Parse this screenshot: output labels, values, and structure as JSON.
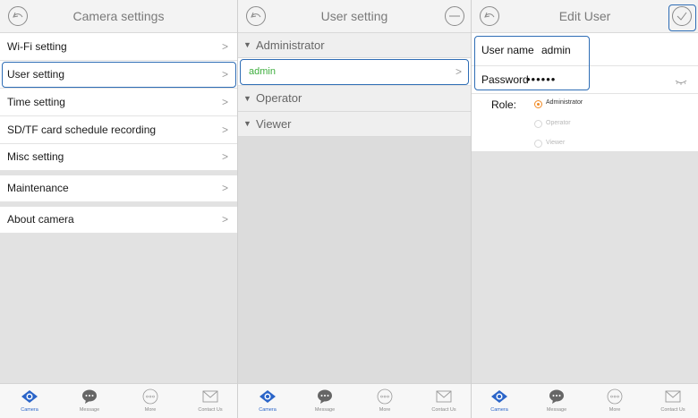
{
  "colors": {
    "accent": "#2a64c8",
    "highlight": "#2e6db5",
    "active_user": "#3fae3f",
    "radio_on": "#f08a25"
  },
  "panel1": {
    "title": "Camera settings",
    "back_icon": "back-arrow-icon",
    "items": [
      {
        "label": "Wi-Fi setting"
      },
      {
        "label": "User setting"
      },
      {
        "label": "Time setting"
      },
      {
        "label": "SD/TF card schedule recording"
      },
      {
        "label": "Misc setting"
      },
      {
        "label": "Maintenance"
      },
      {
        "label": "About camera"
      }
    ],
    "chevron": ">"
  },
  "panel2": {
    "title": "User setting",
    "groups": {
      "administrator": "Administrator",
      "operator": "Operator",
      "viewer": "Viewer"
    },
    "admin_user": "admin",
    "chevron": ">"
  },
  "panel3": {
    "title": "Edit User",
    "username_label": "User name",
    "username_value": "admin",
    "password_label": "Password",
    "password_value": "••••••",
    "role_label": "Role:",
    "roles": [
      {
        "label": "Administrator",
        "selected": true
      },
      {
        "label": "Operator",
        "selected": false
      },
      {
        "label": "Viewer",
        "selected": false
      }
    ]
  },
  "tabs": [
    {
      "label": "Camera",
      "icon": "camera-eye-icon",
      "active": true
    },
    {
      "label": "Message",
      "icon": "message-bubble-icon",
      "active": false
    },
    {
      "label": "More",
      "icon": "more-dots-icon",
      "active": false
    },
    {
      "label": "Contact Us",
      "icon": "envelope-icon",
      "active": false
    }
  ]
}
